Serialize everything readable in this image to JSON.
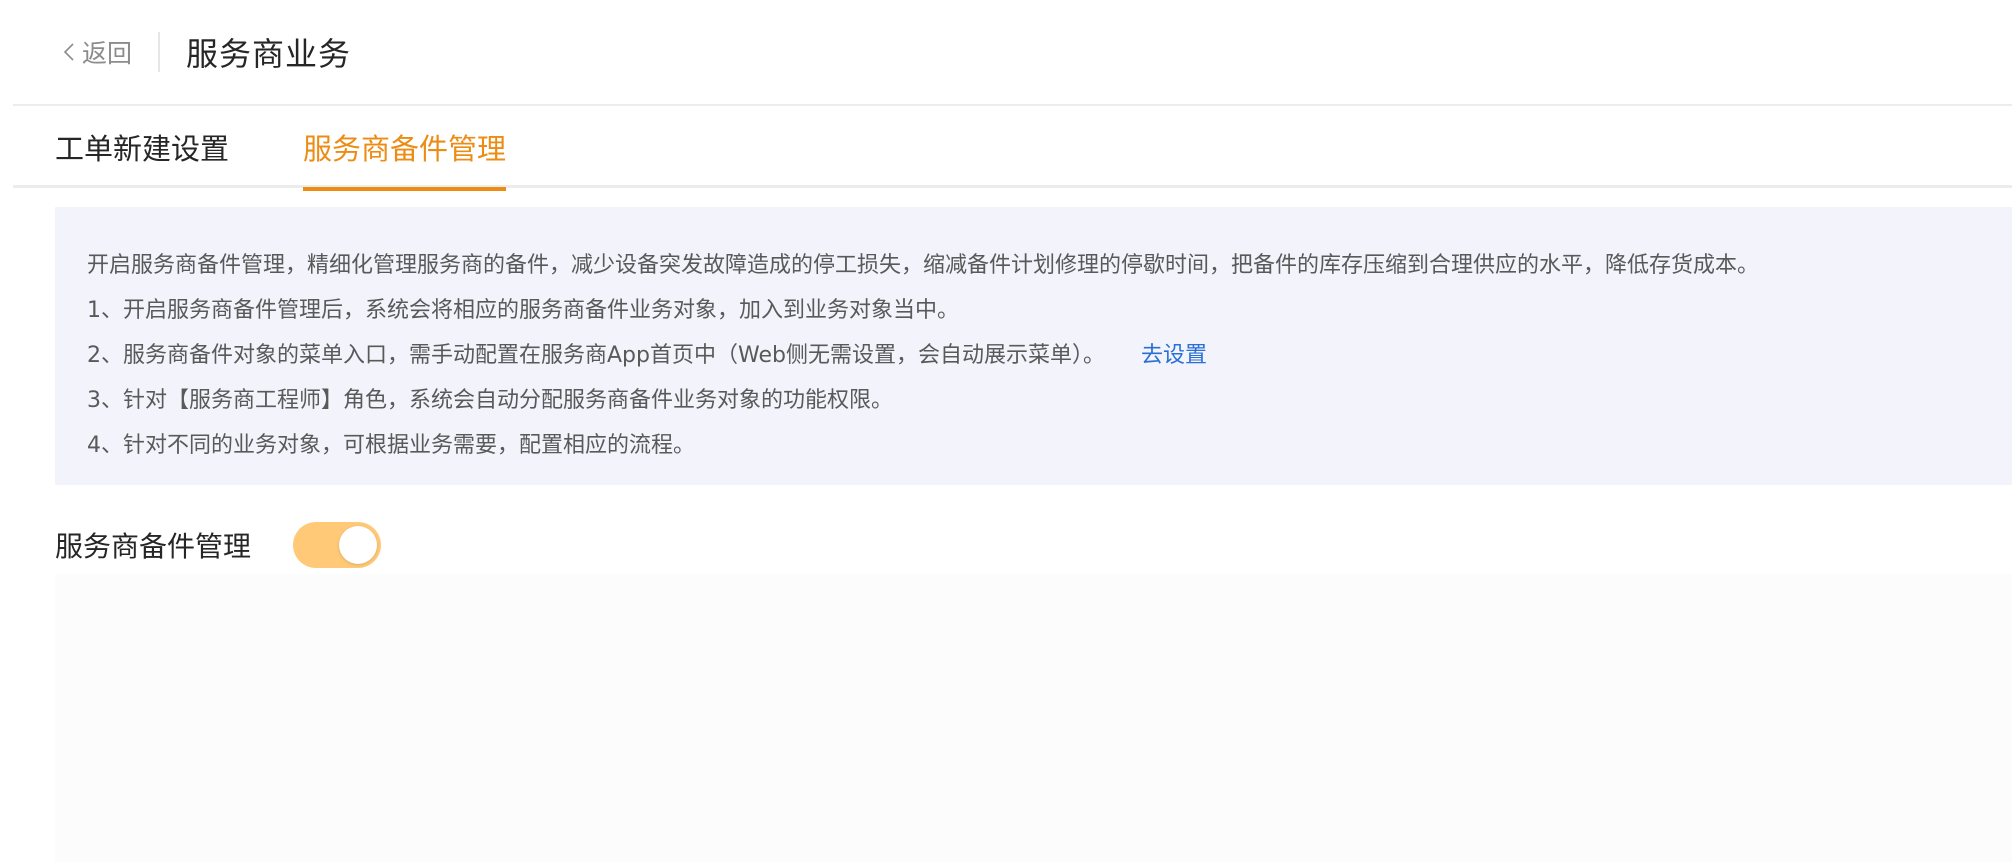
{
  "header": {
    "back_label": "返回",
    "title": "服务商业务"
  },
  "tabs": [
    {
      "label": "工单新建设置",
      "active": false
    },
    {
      "label": "服务商备件管理",
      "active": true
    }
  ],
  "info": {
    "lines": [
      "开启服务商备件管理，精细化管理服务商的备件，减少设备突发故障造成的停工损失，缩减备件计划修理的停歇时间，把备件的库存压缩到合理供应的水平，降低存货成本。",
      "1、开启服务商备件管理后，系统会将相应的服务商备件业务对象，加入到业务对象当中。",
      "2、服务商备件对象的菜单入口，需手动配置在服务商App首页中（Web侧无需设置，会自动展示菜单）。",
      "3、针对【服务商工程师】角色，系统会自动分配服务商备件业务对象的功能权限。",
      "4、针对不同的业务对象，可根据业务需要，配置相应的流程。"
    ],
    "link_label": "去设置"
  },
  "setting": {
    "label": "服务商备件管理",
    "enabled": true
  },
  "colors": {
    "accent": "#ec8c14",
    "toggle_on": "#ffc978",
    "link": "#2a6fd6",
    "info_bg": "#f2f3fb"
  },
  "icons": {
    "back": "chevron-left-icon"
  }
}
